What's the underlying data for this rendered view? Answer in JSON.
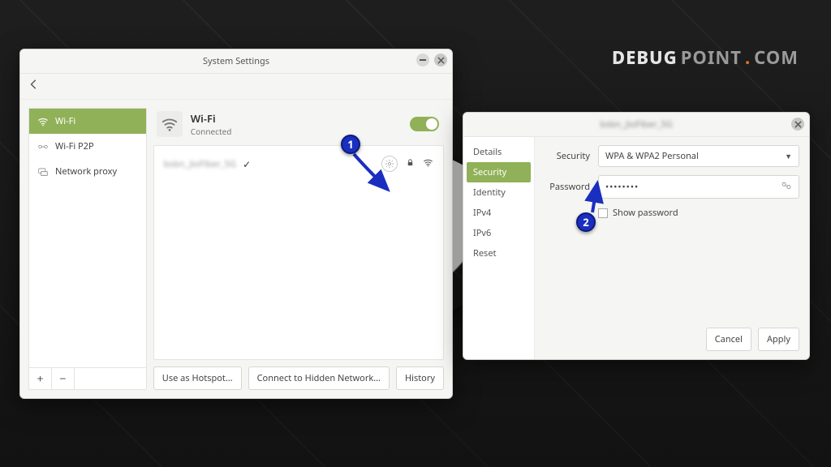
{
  "watermark": {
    "left": "DEBUG",
    "mid": "POINT",
    "dot": ".",
    "right": "COM"
  },
  "settings": {
    "title": "System Settings",
    "sidebar": {
      "items": [
        {
          "label": "Wi-Fi"
        },
        {
          "label": "Wi-Fi P2P"
        },
        {
          "label": "Network proxy"
        }
      ]
    },
    "main": {
      "title": "Wi-Fi",
      "subtitle": "Connected",
      "network": {
        "ssid_blurred": "bsbn_JioFiber_5G",
        "connected": true
      },
      "buttons": {
        "hotspot": "Use as Hotspot…",
        "hidden": "Connect to Hidden Network…",
        "history": "History"
      }
    }
  },
  "dialog": {
    "title_blurred": "bsbn_JioFiber_5G",
    "tabs": [
      "Details",
      "Security",
      "Identity",
      "IPv4",
      "IPv6",
      "Reset"
    ],
    "active_tab": "Security",
    "security": {
      "label": "Security",
      "value": "WPA & WPA2 Personal"
    },
    "password": {
      "label": "Password",
      "masked": "••••••••",
      "show_label": "Show password"
    },
    "buttons": {
      "cancel": "Cancel",
      "apply": "Apply"
    }
  },
  "annotations": {
    "one": "1",
    "two": "2"
  }
}
